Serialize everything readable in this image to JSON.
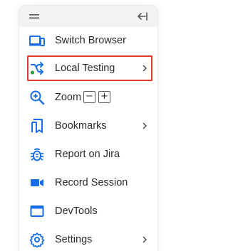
{
  "toolbar": {
    "drag_icon": "drag-handle-icon",
    "collapse_icon": "collapse-panel-icon"
  },
  "menu": {
    "items": [
      {
        "label": "Switch Browser",
        "icon": "switch-browser-icon"
      },
      {
        "label": "Local Testing",
        "icon": "local-testing-icon",
        "has_submenu": true,
        "highlighted": true
      },
      {
        "label": "Zoom",
        "icon": "zoom-icon",
        "zoom_out": "−",
        "zoom_in": "+"
      },
      {
        "label": "Bookmarks",
        "icon": "bookmark-icon",
        "has_submenu": true
      },
      {
        "label": "Report on Jira",
        "icon": "bug-icon"
      },
      {
        "label": "Record Session",
        "icon": "video-camera-icon"
      },
      {
        "label": "DevTools",
        "icon": "devtools-icon"
      },
      {
        "label": "Settings",
        "icon": "settings-gear-icon",
        "has_submenu": true
      }
    ]
  },
  "colors": {
    "accent_blue": "#1a6ee8",
    "highlight_red": "#e03a2a",
    "status_green": "#2e9e46",
    "text": "#2a2a2a"
  }
}
